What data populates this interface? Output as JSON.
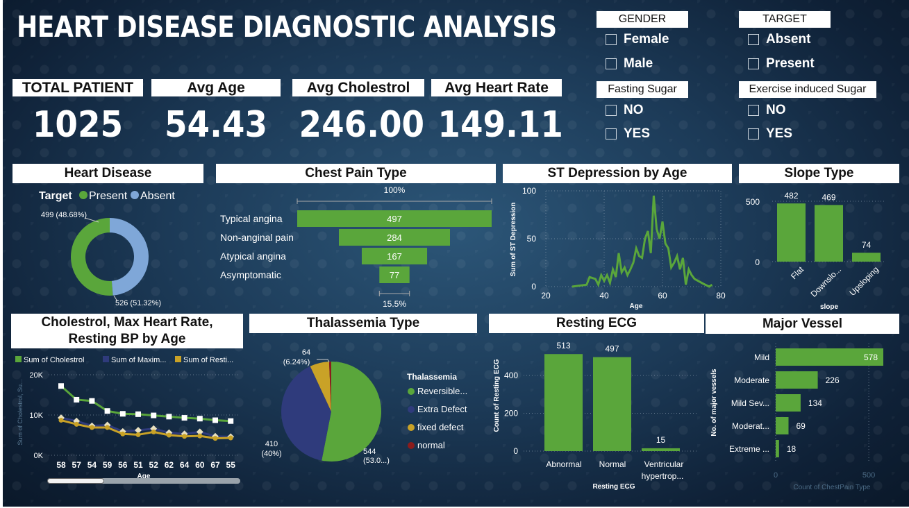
{
  "title": "HEART DISEASE DIAGNOSTIC ANALYSIS",
  "kpis": [
    {
      "label": "TOTAL PATIENT",
      "value": "1025"
    },
    {
      "label": "Avg Age",
      "value": "54.43"
    },
    {
      "label": "Avg Cholestrol",
      "value": "246.00"
    },
    {
      "label": "Avg Heart Rate",
      "value": "149.11"
    }
  ],
  "slicers": {
    "gender": {
      "title": "GENDER",
      "options": [
        "Female",
        "Male"
      ]
    },
    "target": {
      "title": "TARGET",
      "options": [
        "Absent",
        "Present"
      ]
    },
    "fasting": {
      "title": "Fasting Sugar",
      "options": [
        "NO",
        "YES"
      ]
    },
    "exercise": {
      "title": "Exercise induced Sugar",
      "options": [
        "NO",
        "YES"
      ]
    }
  },
  "colors": {
    "green": "#5aa63b",
    "blue": "#7fa7d8",
    "navy": "#2f3b7c",
    "gold": "#c9a227",
    "darkred": "#8b1c1c",
    "white": "#ffffff"
  },
  "panels": {
    "heart": "Heart Disease",
    "chest": "Chest Pain Type",
    "st": "ST Depression by Age",
    "slope": "Slope Type",
    "chol": "Cholestrol, Max Heart Rate, Resting BP by Age",
    "thal": "Thalassemia Type",
    "ecg": "Resting ECG",
    "vessel": "Major Vessel"
  },
  "chart_data": [
    {
      "type": "pie",
      "title": "Heart Disease",
      "legend_title": "Target",
      "labels": [
        "Present",
        "Absent"
      ],
      "values": [
        526,
        499
      ],
      "data_labels": [
        "526 (51.32%)",
        "499 (48.68%)"
      ]
    },
    {
      "type": "bar",
      "title": "Chest Pain Type",
      "categories": [
        "Typical angina",
        "Non-anginal pain",
        "Atypical angina",
        "Asymptomatic"
      ],
      "values": [
        497,
        284,
        167,
        77
      ],
      "top_label": "100%",
      "bottom_label": "15.5%"
    },
    {
      "type": "line",
      "title": "ST Depression by Age",
      "xlabel": "Age",
      "ylabel": "Sum of ST Depression",
      "xlim": [
        20,
        80
      ],
      "ylim": [
        0,
        100
      ],
      "xticks": [
        "20",
        "40",
        "60",
        "80"
      ],
      "yticks": [
        "0",
        "50",
        "100"
      ],
      "x": [
        29,
        34,
        35,
        37,
        38,
        39,
        40,
        41,
        42,
        43,
        44,
        45,
        46,
        47,
        48,
        49,
        50,
        51,
        52,
        53,
        54,
        55,
        56,
        57,
        58,
        59,
        60,
        61,
        62,
        63,
        64,
        65,
        66,
        67,
        68,
        69,
        70,
        71,
        74,
        76,
        77
      ],
      "y": [
        0,
        2,
        10,
        8,
        2,
        12,
        6,
        12,
        4,
        18,
        10,
        35,
        15,
        20,
        12,
        18,
        25,
        40,
        32,
        30,
        50,
        58,
        35,
        95,
        60,
        50,
        68,
        45,
        40,
        20,
        25,
        32,
        18,
        30,
        2,
        18,
        12,
        8,
        3,
        0,
        2
      ]
    },
    {
      "type": "bar",
      "title": "Slope Type",
      "xlabel": "slope",
      "categories": [
        "Flat",
        "Downslo...",
        "Upsloping"
      ],
      "values": [
        482,
        469,
        74
      ],
      "yticks": [
        "0",
        "500"
      ],
      "ylim": [
        0,
        520
      ]
    },
    {
      "type": "line",
      "title": "Cholestrol, Max Heart Rate, Resting BP by Age",
      "xlabel": "Age",
      "ylabel": "Sum of Cholestrol, Su...",
      "categories": [
        "58",
        "57",
        "54",
        "59",
        "56",
        "51",
        "52",
        "62",
        "64",
        "60",
        "67",
        "55"
      ],
      "yticks": [
        "0K",
        "10K",
        "20K"
      ],
      "ylim": [
        0,
        20000
      ],
      "series": [
        {
          "name": "Sum of Cholestrol",
          "values": [
            17200,
            13800,
            13500,
            11000,
            10300,
            10200,
            9900,
            9600,
            9300,
            9100,
            8700,
            8500
          ]
        },
        {
          "name": "Sum of Maxim...",
          "values": [
            9300,
            8500,
            7300,
            7500,
            5900,
            6200,
            6600,
            5600,
            5300,
            5800,
            4700,
            4600
          ]
        },
        {
          "name": "Sum of Resti...",
          "values": [
            8700,
            7700,
            6900,
            6900,
            5300,
            5100,
            5800,
            5000,
            4700,
            4800,
            4200,
            4300
          ]
        }
      ]
    },
    {
      "type": "pie",
      "title": "Thalassemia Type",
      "legend_title": "Thalassemia",
      "labels": [
        "Reversible...",
        "Extra Defect",
        "fixed defect",
        "normal"
      ],
      "values": [
        544,
        410,
        64,
        7
      ],
      "data_labels": [
        "544 (53.0...)",
        "410 (40%)",
        "64 (6.24%)",
        ""
      ]
    },
    {
      "type": "bar",
      "title": "Resting ECG",
      "xlabel": "Resting ECG",
      "ylabel": "Count of Resting ECG",
      "categories": [
        "Abnormal",
        "Normal",
        "Ventricular hypertrop..."
      ],
      "values": [
        513,
        497,
        15
      ],
      "yticks": [
        "0",
        "200",
        "400"
      ],
      "ylim": [
        0,
        560
      ]
    },
    {
      "type": "bar",
      "title": "Major Vessel",
      "xlabel": "Count of ChestPain Type",
      "ylabel": "No. of major vessels",
      "categories": [
        "Mild",
        "Moderate",
        "Mild Sev...",
        "Moderat...",
        "Extreme ..."
      ],
      "values": [
        578,
        226,
        134,
        69,
        18
      ],
      "xticks": [
        "0",
        "500"
      ],
      "xlim": [
        0,
        620
      ]
    }
  ]
}
